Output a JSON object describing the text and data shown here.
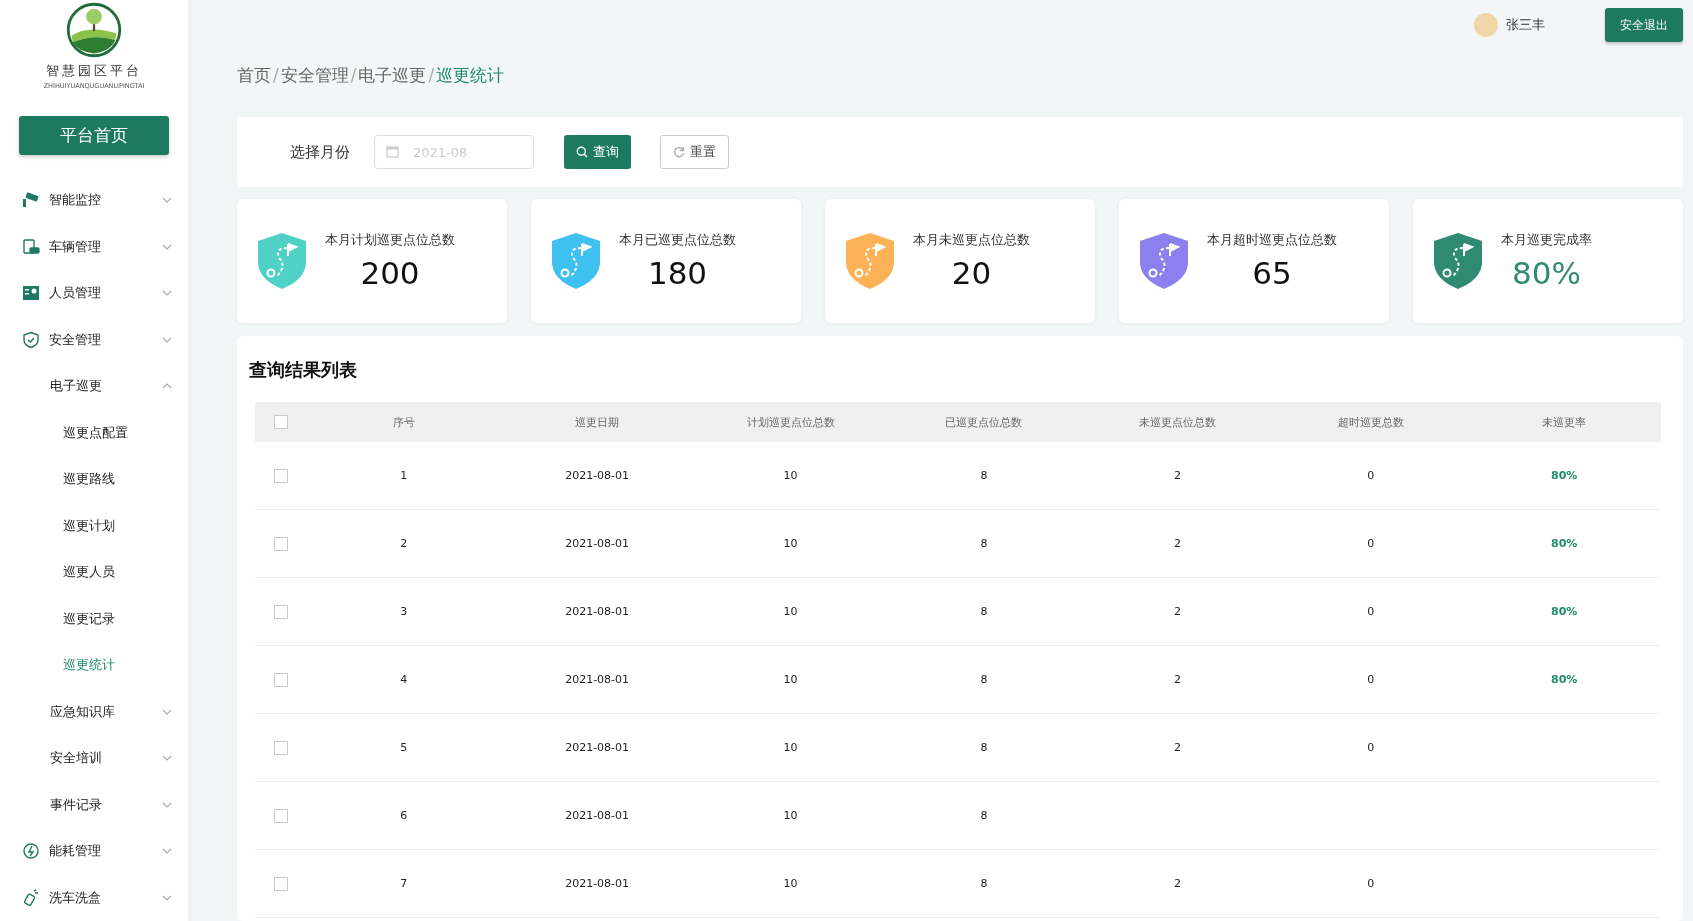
{
  "brand": {
    "title": "智慧园区平台",
    "subtitle": "ZHIHUIYUANQUGUANLIPINGTAI"
  },
  "home_button": "平台首页",
  "sidebar": {
    "items": [
      {
        "label": "智能监控",
        "expanded": false
      },
      {
        "label": "车辆管理",
        "expanded": false
      },
      {
        "label": "人员管理",
        "expanded": false
      },
      {
        "label": "安全管理",
        "expanded": false,
        "children": [
          {
            "label": "电子巡更",
            "expanded": true,
            "children": [
              {
                "label": "巡更点配置",
                "selected": false
              },
              {
                "label": "巡更路线",
                "selected": false
              },
              {
                "label": "巡更计划",
                "selected": false
              },
              {
                "label": "巡更人员",
                "selected": false
              },
              {
                "label": "巡更记录",
                "selected": false
              },
              {
                "label": "巡更统计",
                "selected": true
              }
            ]
          },
          {
            "label": "应急知识库",
            "expanded": false
          },
          {
            "label": "安全培训",
            "expanded": false
          },
          {
            "label": "事件记录",
            "expanded": false
          }
        ]
      },
      {
        "label": "能耗管理",
        "expanded": false
      },
      {
        "label": "洗车洗盒",
        "expanded": false
      }
    ]
  },
  "header": {
    "user": "张三丰",
    "logout": "安全退出"
  },
  "breadcrumb": {
    "separator": "/",
    "items": [
      "首页",
      "安全管理",
      "电子巡更",
      "巡更统计"
    ]
  },
  "filter": {
    "label": "选择月份",
    "placeholder": "2021-08",
    "search": "查询",
    "reset": "重置"
  },
  "stats": [
    {
      "label": "本月计划巡更点位总数",
      "value": "200",
      "color": "#4fd1c5",
      "kind": "count"
    },
    {
      "label": "本月已巡更点位总数",
      "value": "180",
      "color": "#3ec0f0",
      "kind": "count"
    },
    {
      "label": "本月未巡更点位总数",
      "value": "20",
      "color": "#fbb256",
      "kind": "count"
    },
    {
      "label": "本月超时巡更点位总数",
      "value": "65",
      "color": "#8b80ee",
      "kind": "count"
    },
    {
      "label": "本月巡更完成率",
      "value": "80%",
      "color": "#2e8b72",
      "kind": "rate"
    }
  ],
  "table": {
    "title": "查询结果列表",
    "header_checked": false,
    "columns": [
      "序号",
      "巡更日期",
      "计划巡更点位总数",
      "已巡更点位总数",
      "未巡更点位总数",
      "超时巡更总数",
      "未巡更率"
    ],
    "rows": [
      {
        "checked": false,
        "cells": [
          "1",
          "2021-08-01",
          "10",
          "8",
          "2",
          "0",
          "80%"
        ]
      },
      {
        "checked": false,
        "cells": [
          "2",
          "2021-08-01",
          "10",
          "8",
          "2",
          "0",
          "80%"
        ]
      },
      {
        "checked": false,
        "cells": [
          "3",
          "2021-08-01",
          "10",
          "8",
          "2",
          "0",
          "80%"
        ]
      },
      {
        "checked": false,
        "cells": [
          "4",
          "2021-08-01",
          "10",
          "8",
          "2",
          "0",
          "80%"
        ]
      },
      {
        "checked": false,
        "cells": [
          "5",
          "2021-08-01",
          "10",
          "8",
          "2",
          "0"
        ]
      },
      {
        "checked": false,
        "cells": [
          "6",
          "2021-08-01",
          "10",
          "8"
        ]
      },
      {
        "checked": false,
        "cells": [
          "7",
          "2021-08-01",
          "10",
          "8",
          "2",
          "0"
        ]
      }
    ]
  }
}
